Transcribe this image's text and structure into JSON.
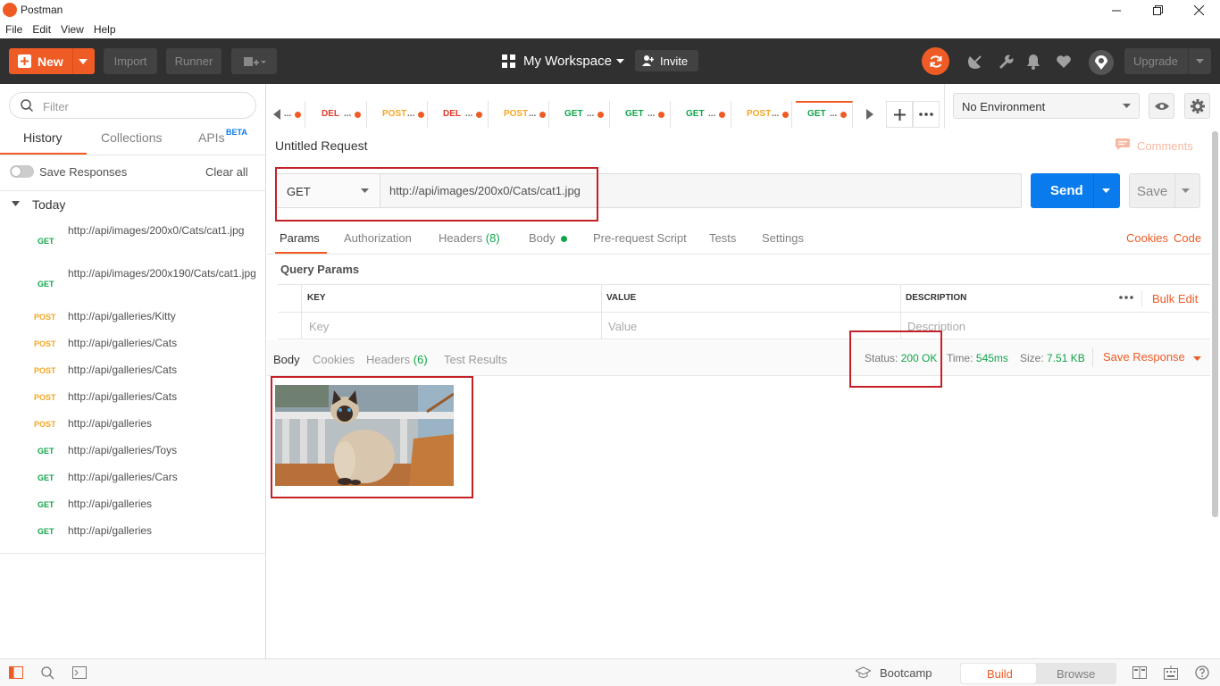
{
  "window": {
    "title": "Postman"
  },
  "menu": [
    "File",
    "Edit",
    "View",
    "Help"
  ],
  "toolbar": {
    "new_label": "New",
    "import_label": "Import",
    "runner_label": "Runner",
    "workspace_label": "My Workspace",
    "invite_label": "Invite",
    "upgrade_label": "Upgrade"
  },
  "sidebar": {
    "filter_placeholder": "Filter",
    "tabs": {
      "history": "History",
      "collections": "Collections",
      "apis": "APIs",
      "apis_badge": "BETA"
    },
    "save_responses_label": "Save Responses",
    "clear_all_label": "Clear all",
    "group_label": "Today",
    "items": [
      {
        "method": "GET",
        "url": "http://api/images/200x0/Cats/cat1.jpg"
      },
      {
        "method": "GET",
        "url": "http://api/images/200x190/Cats/cat1.jpg"
      },
      {
        "method": "POST",
        "url": "http://api/galleries/Kitty"
      },
      {
        "method": "POST",
        "url": "http://api/galleries/Cats"
      },
      {
        "method": "POST",
        "url": "http://api/galleries/Cats"
      },
      {
        "method": "POST",
        "url": "http://api/galleries/Cats"
      },
      {
        "method": "POST",
        "url": "http://api/galleries"
      },
      {
        "method": "GET",
        "url": "http://api/galleries/Toys"
      },
      {
        "method": "GET",
        "url": "http://api/galleries/Cars"
      },
      {
        "method": "GET",
        "url": "http://api/galleries"
      },
      {
        "method": "GET",
        "url": "http://api/galleries"
      }
    ]
  },
  "request_tabs": [
    {
      "method": "",
      "label": "..."
    },
    {
      "method": "DEL",
      "label": "..."
    },
    {
      "method": "POST",
      "label": "..."
    },
    {
      "method": "DEL",
      "label": "..."
    },
    {
      "method": "POST",
      "label": "..."
    },
    {
      "method": "GET",
      "label": "..."
    },
    {
      "method": "GET",
      "label": "..."
    },
    {
      "method": "GET",
      "label": "..."
    },
    {
      "method": "POST",
      "label": "..."
    },
    {
      "method": "GET",
      "label": "..."
    }
  ],
  "environment": {
    "selected": "No Environment"
  },
  "request": {
    "name": "Untitled Request",
    "comments_label": "Comments",
    "method": "GET",
    "url": "http://api/images/200x0/Cats/cat1.jpg",
    "send_label": "Send",
    "save_label": "Save",
    "tabs": {
      "params": "Params",
      "authorization": "Authorization",
      "headers": "Headers",
      "headers_count": "(8)",
      "body": "Body",
      "prerequest": "Pre-request Script",
      "tests": "Tests",
      "settings": "Settings"
    },
    "cookies_link": "Cookies",
    "code_link": "Code",
    "query_params_label": "Query Params",
    "table_headers": {
      "key": "KEY",
      "value": "VALUE",
      "description": "DESCRIPTION"
    },
    "bulk_edit_label": "Bulk Edit",
    "placeholders": {
      "key": "Key",
      "value": "Value",
      "description": "Description"
    }
  },
  "response": {
    "tabs": {
      "body": "Body",
      "cookies": "Cookies",
      "headers": "Headers",
      "headers_count": "(6)",
      "test_results": "Test Results"
    },
    "status_label": "Status:",
    "status_value": "200 OK",
    "time_label": "Time:",
    "time_value": "545ms",
    "size_label": "Size:",
    "size_value": "7.51 KB",
    "save_response_label": "Save Response"
  },
  "bottombar": {
    "bootcamp_label": "Bootcamp",
    "build_label": "Build",
    "browse_label": "Browse"
  },
  "colors": {
    "accent": "#ef5b25",
    "send_blue": "#097bed",
    "get_green": "#10a54a",
    "post_yellow": "#f5a623",
    "del_red": "#e23b2e",
    "annotation_red": "#c42127"
  }
}
